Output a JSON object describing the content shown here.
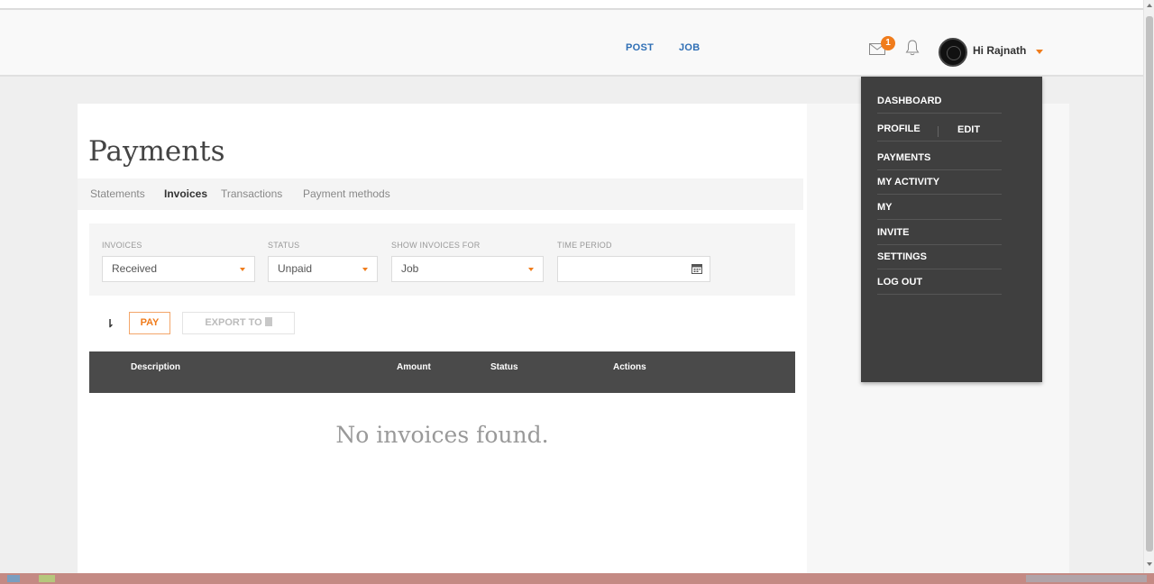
{
  "header": {
    "nav": [
      "POST",
      "JOB"
    ],
    "mail_badge": "1",
    "greeting": "Hi Rajnath"
  },
  "page": {
    "title": "Payments",
    "subtabs": [
      {
        "label": "Statements",
        "active": false
      },
      {
        "label": "Invoices",
        "active": true
      },
      {
        "label": "Transactions",
        "active": false
      },
      {
        "label": "Payment methods",
        "active": false
      }
    ]
  },
  "filters": {
    "invoices": {
      "label": "INVOICES",
      "value": "Received"
    },
    "status": {
      "label": "STATUS",
      "value": "Unpaid"
    },
    "show_for": {
      "label": "SHOW INVOICES FOR",
      "value": "Job"
    },
    "time_period": {
      "label": "TIME PERIOD",
      "value": ""
    }
  },
  "actions": {
    "pay": "PAY",
    "export": "EXPORT TO"
  },
  "table": {
    "columns": [
      "Description",
      "Amount",
      "Status",
      "Actions"
    ],
    "empty_message": "No invoices found."
  },
  "user_menu": {
    "items": [
      "DASHBOARD",
      "PROFILE",
      "PAYMENTS",
      "MY ACTIVITY",
      "MY",
      "INVITE",
      "SETTINGS",
      "LOG OUT"
    ],
    "edit": "EDIT"
  },
  "colors": {
    "accent": "#f07c1c",
    "nav_link": "#2f6fb5",
    "table_header": "#4a4a4a",
    "menu_bg": "#3f3f3f"
  }
}
